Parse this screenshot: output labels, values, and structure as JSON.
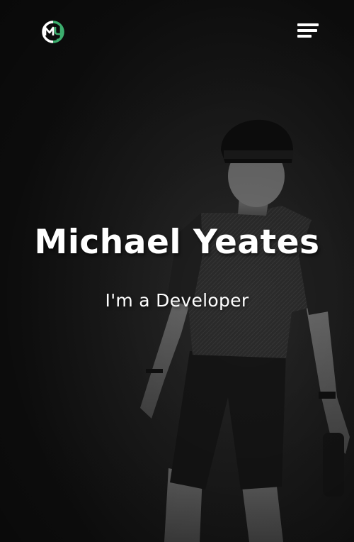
{
  "header": {
    "logo_icon": "my-monogram-logo-icon",
    "menu_icon": "hamburger-menu-icon"
  },
  "hero": {
    "name": "Michael Yeates",
    "tagline": "I'm a Developer",
    "background": "monochrome-photo-cyclist-jersey"
  },
  "colors": {
    "background": "#121212",
    "text": "#ffffff",
    "accent": "#3cae6e"
  }
}
